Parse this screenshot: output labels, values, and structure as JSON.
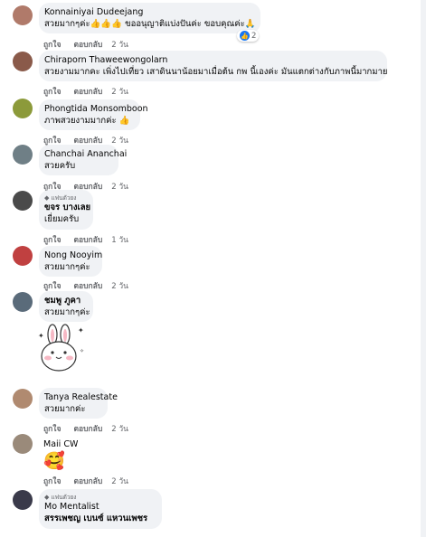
{
  "comments": [
    {
      "name": "Konnainiyai Dudeejang",
      "text": "สวยมากๆค่ะ👍👍👍 ขออนุญาติแบ่งปันค่ะ ขอบคุณค่ะ🙏",
      "like": "ถูกใจ",
      "reply": "ตอบกลับ",
      "time": "2 วัน",
      "reaction_count": "2",
      "avatar_color": "#b07a6a"
    },
    {
      "name": "Chiraporn Thaweewongolarn",
      "text": "สวยงามมากคะ เพิ่งไปเที่ยว เสาดินนาน้อยมาเมื่อต้น กพ นี้เองค่ะ มันแตกต่างกับภาพนี้มากมาย",
      "like": "ถูกใจ",
      "reply": "ตอบกลับ",
      "time": "2 วัน",
      "avatar_color": "#8a5a4a"
    },
    {
      "name": "Phongtida Monsomboon",
      "text": "ภาพสวยงามมากค่ะ 👍",
      "like": "ถูกใจ",
      "reply": "ตอบกลับ",
      "time": "2 วัน",
      "avatar_color": "#8c9a3a"
    },
    {
      "name": "Chanchai Ananchai",
      "text": "สวยครับ",
      "like": "ถูกใจ",
      "reply": "ตอบกลับ",
      "time": "2 วัน",
      "avatar_color": "#6f7f86"
    },
    {
      "fan_label": "แฟนตัวยง",
      "name": "ขจร บางเลย",
      "text": "เยี่ยมครับ",
      "like": "ถูกใจ",
      "reply": "ตอบกลับ",
      "time": "1 วัน",
      "avatar_color": "#4a4a4a"
    },
    {
      "name": "Nong Nooyim",
      "text": "สวยมากๆค่ะ",
      "like": "ถูกใจ",
      "reply": "ตอบกลับ",
      "time": "2 วัน",
      "avatar_color": "#c04040"
    },
    {
      "name": "ชมพู ภูคา",
      "text": "สวยมากๆค่ะ",
      "like": "ถูกใจ",
      "reply": "ตอบกลับ",
      "time": "2 วัน",
      "avatar_color": "#5a6b7a",
      "sticker": "bunny-sticker"
    },
    {
      "name": "Tanya Realestate",
      "text": "สวยมากค่ะ",
      "like": "ถูกใจ",
      "reply": "ตอบกลับ",
      "time": "2 วัน",
      "avatar_color": "#b08a70"
    },
    {
      "name": "Maii CW",
      "text": "🥰",
      "like": "ถูกใจ",
      "reply": "ตอบกลับ",
      "time": "2 วัน",
      "avatar_color": "#9a8a7a"
    },
    {
      "fan_label": "แฟนตัวยง",
      "name": "Mo Mentalist",
      "text": "สรรเพชญ เบนซ์ แหวนเพชร",
      "avatar_color": "#3a3a4a"
    }
  ]
}
